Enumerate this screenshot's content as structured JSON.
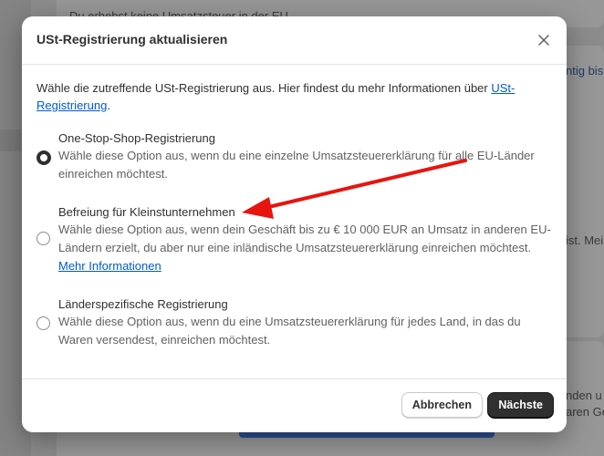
{
  "background": {
    "text_top": "Du erhebst keine Umsatzsteuer in der EU",
    "text_right_1": "ntig bis",
    "text_right_2": "ist. Mei",
    "text_right_3": "nden u",
    "text_right_4": "aren Ge"
  },
  "modal": {
    "title": "USt-Registrierung aktualisieren",
    "intro_text": "Wähle die zutreffende USt-Registrierung aus. Hier findest du mehr Informationen über ",
    "intro_link": "USt-Registrierung",
    "intro_end": ".",
    "options": [
      {
        "title": "One-Stop-Shop-Registrierung",
        "description": "Wähle diese Option aus, wenn du eine einzelne Umsatzsteuererklärung für alle EU-Länder einreichen möchtest.",
        "checked": true
      },
      {
        "title": "Befreiung für Kleinstunternehmen",
        "description": "Wähle diese Option aus, wenn dein Geschäft bis zu € 10 000 EUR an Umsatz in anderen EU-Ländern erzielt, du aber nur eine inländische Umsatzsteuererklärung einreichen möchtest. ",
        "link": "Mehr Informationen",
        "checked": false
      },
      {
        "title": "Länderspezifische Registrierung",
        "description": "Wähle diese Option aus, wenn du eine Umsatzsteuererklärung für jedes Land, in das du Waren versendest, einreichen möchtest.",
        "checked": false
      }
    ],
    "cancel_label": "Abbrechen",
    "next_label": "Nächste"
  },
  "colors": {
    "annotation_arrow": "#e8140f",
    "link": "#005bd3",
    "primary_button": "#303030"
  },
  "icons": {
    "close": "close-icon",
    "arrow": "annotation-arrow-icon"
  }
}
